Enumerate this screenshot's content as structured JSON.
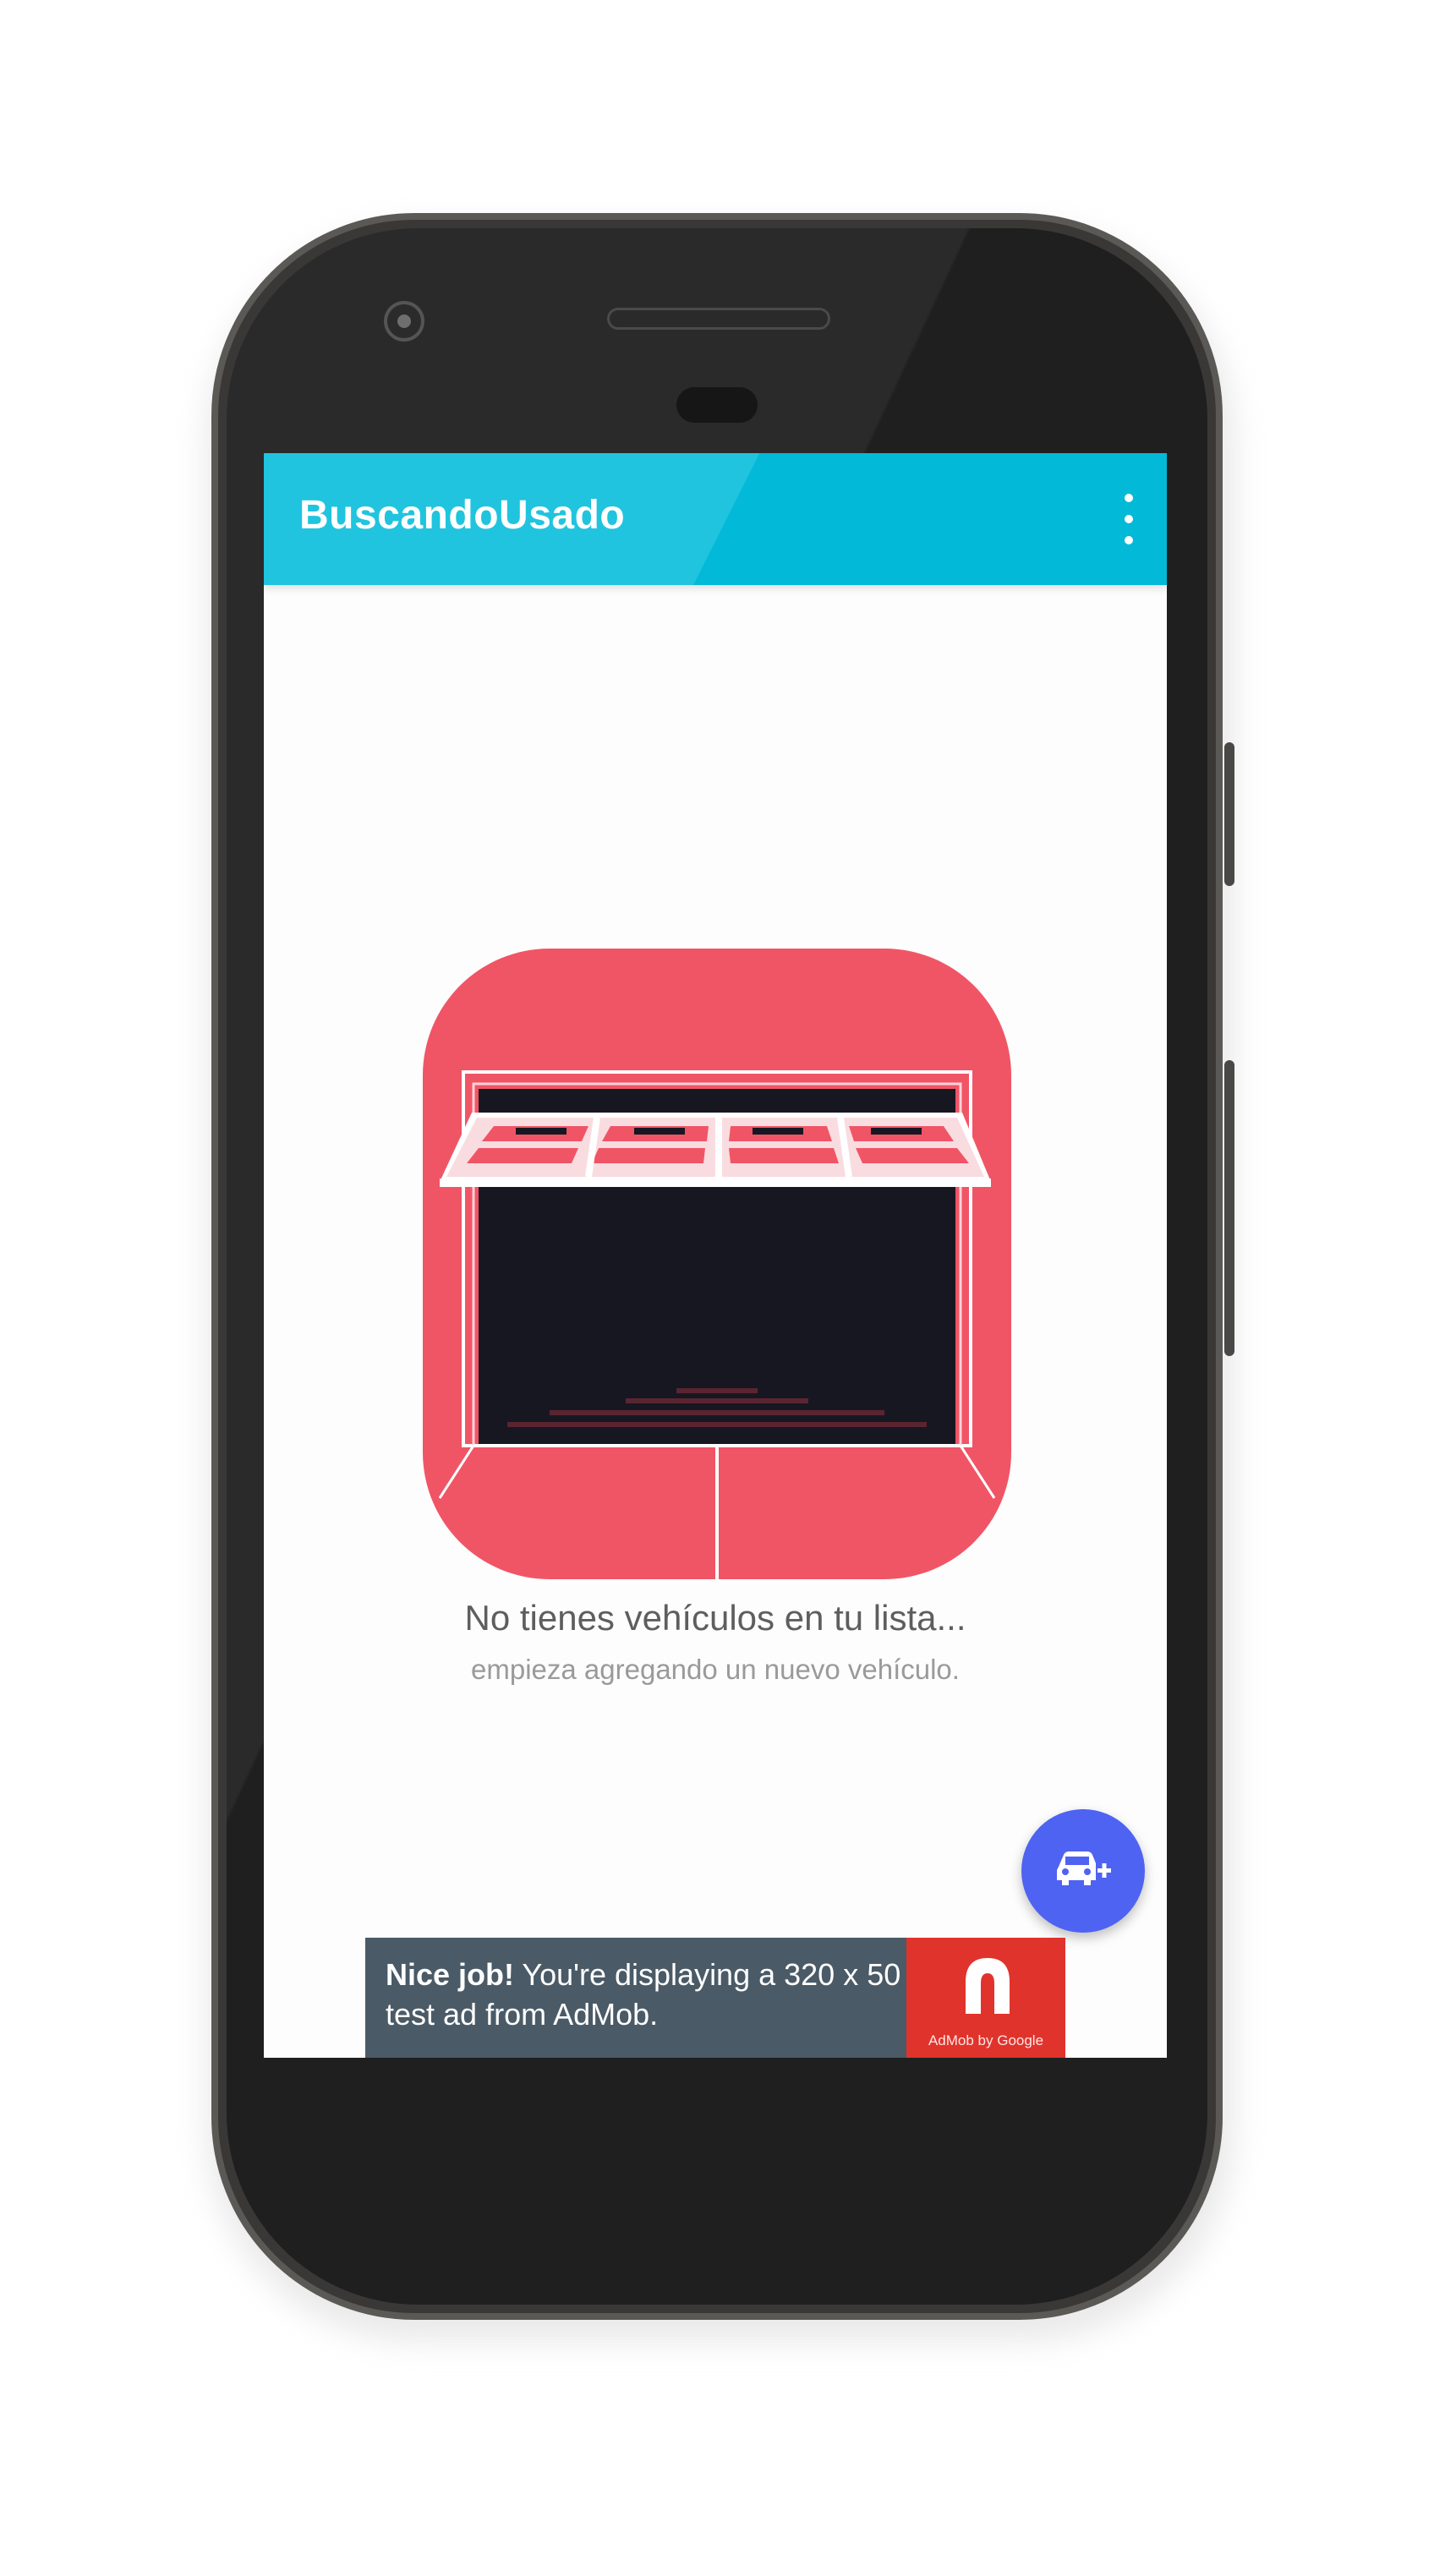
{
  "app": {
    "title": "BuscandoUsado",
    "menu_icon": "more-vert-icon"
  },
  "empty_state": {
    "illustration": "garage-icon",
    "title": "No tienes vehículos en tu lista...",
    "subtitle": "empieza agregando un nuevo vehículo."
  },
  "fab": {
    "icon": "add-car-icon"
  },
  "ad": {
    "bold_text": "Nice job!",
    "text": " You're displaying a 320 x 50 test ad from AdMob.",
    "logo_caption": "AdMob by Google"
  },
  "colors": {
    "appbar": "#20c4de",
    "accent": "#4e63f2",
    "illustration_red": "#f05566",
    "ad_background": "#4a5a66",
    "ad_logo": "#e0332c"
  }
}
